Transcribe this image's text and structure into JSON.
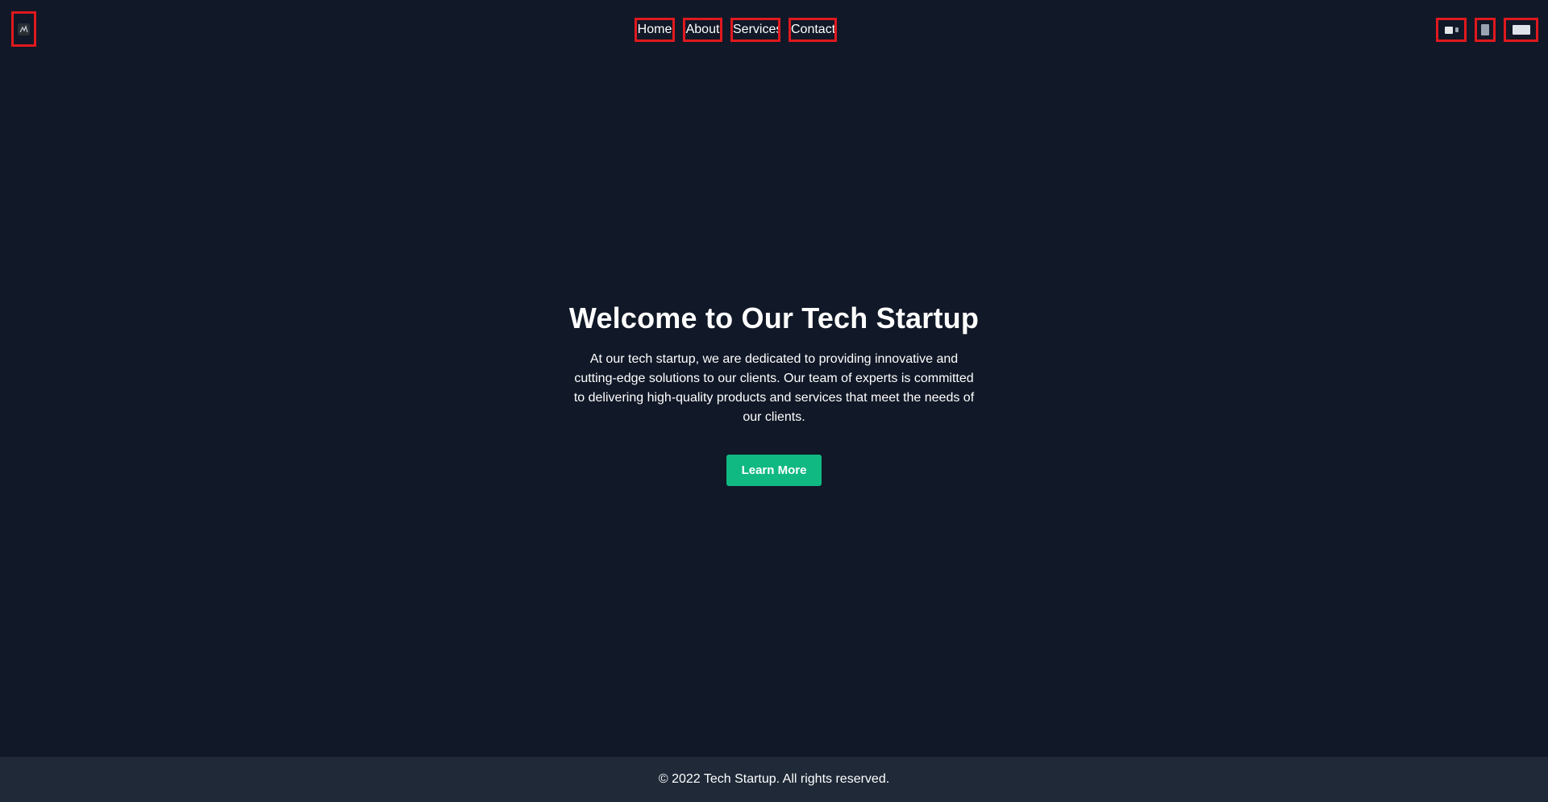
{
  "header": {
    "logo_icon": "logo-image",
    "nav": [
      {
        "label": "Home"
      },
      {
        "label": "About"
      },
      {
        "label": "Services"
      },
      {
        "label": "Contact"
      }
    ],
    "utility_icons": [
      "language-flag-icon",
      "document-icon",
      "user-avatar-icon"
    ]
  },
  "hero": {
    "title": "Welcome to Our Tech Startup",
    "text": "At our tech startup, we are dedicated to providing innovative and cutting-edge solutions to our clients. Our team of experts is committed to delivering high-quality products and services that meet the needs of our clients.",
    "button_label": "Learn More"
  },
  "footer": {
    "text": "© 2022 Tech Startup. All rights reserved."
  },
  "colors": {
    "background": "#111827",
    "footer_background": "#1f2937",
    "accent": "#10b981",
    "highlight_box": "#e0191e"
  }
}
